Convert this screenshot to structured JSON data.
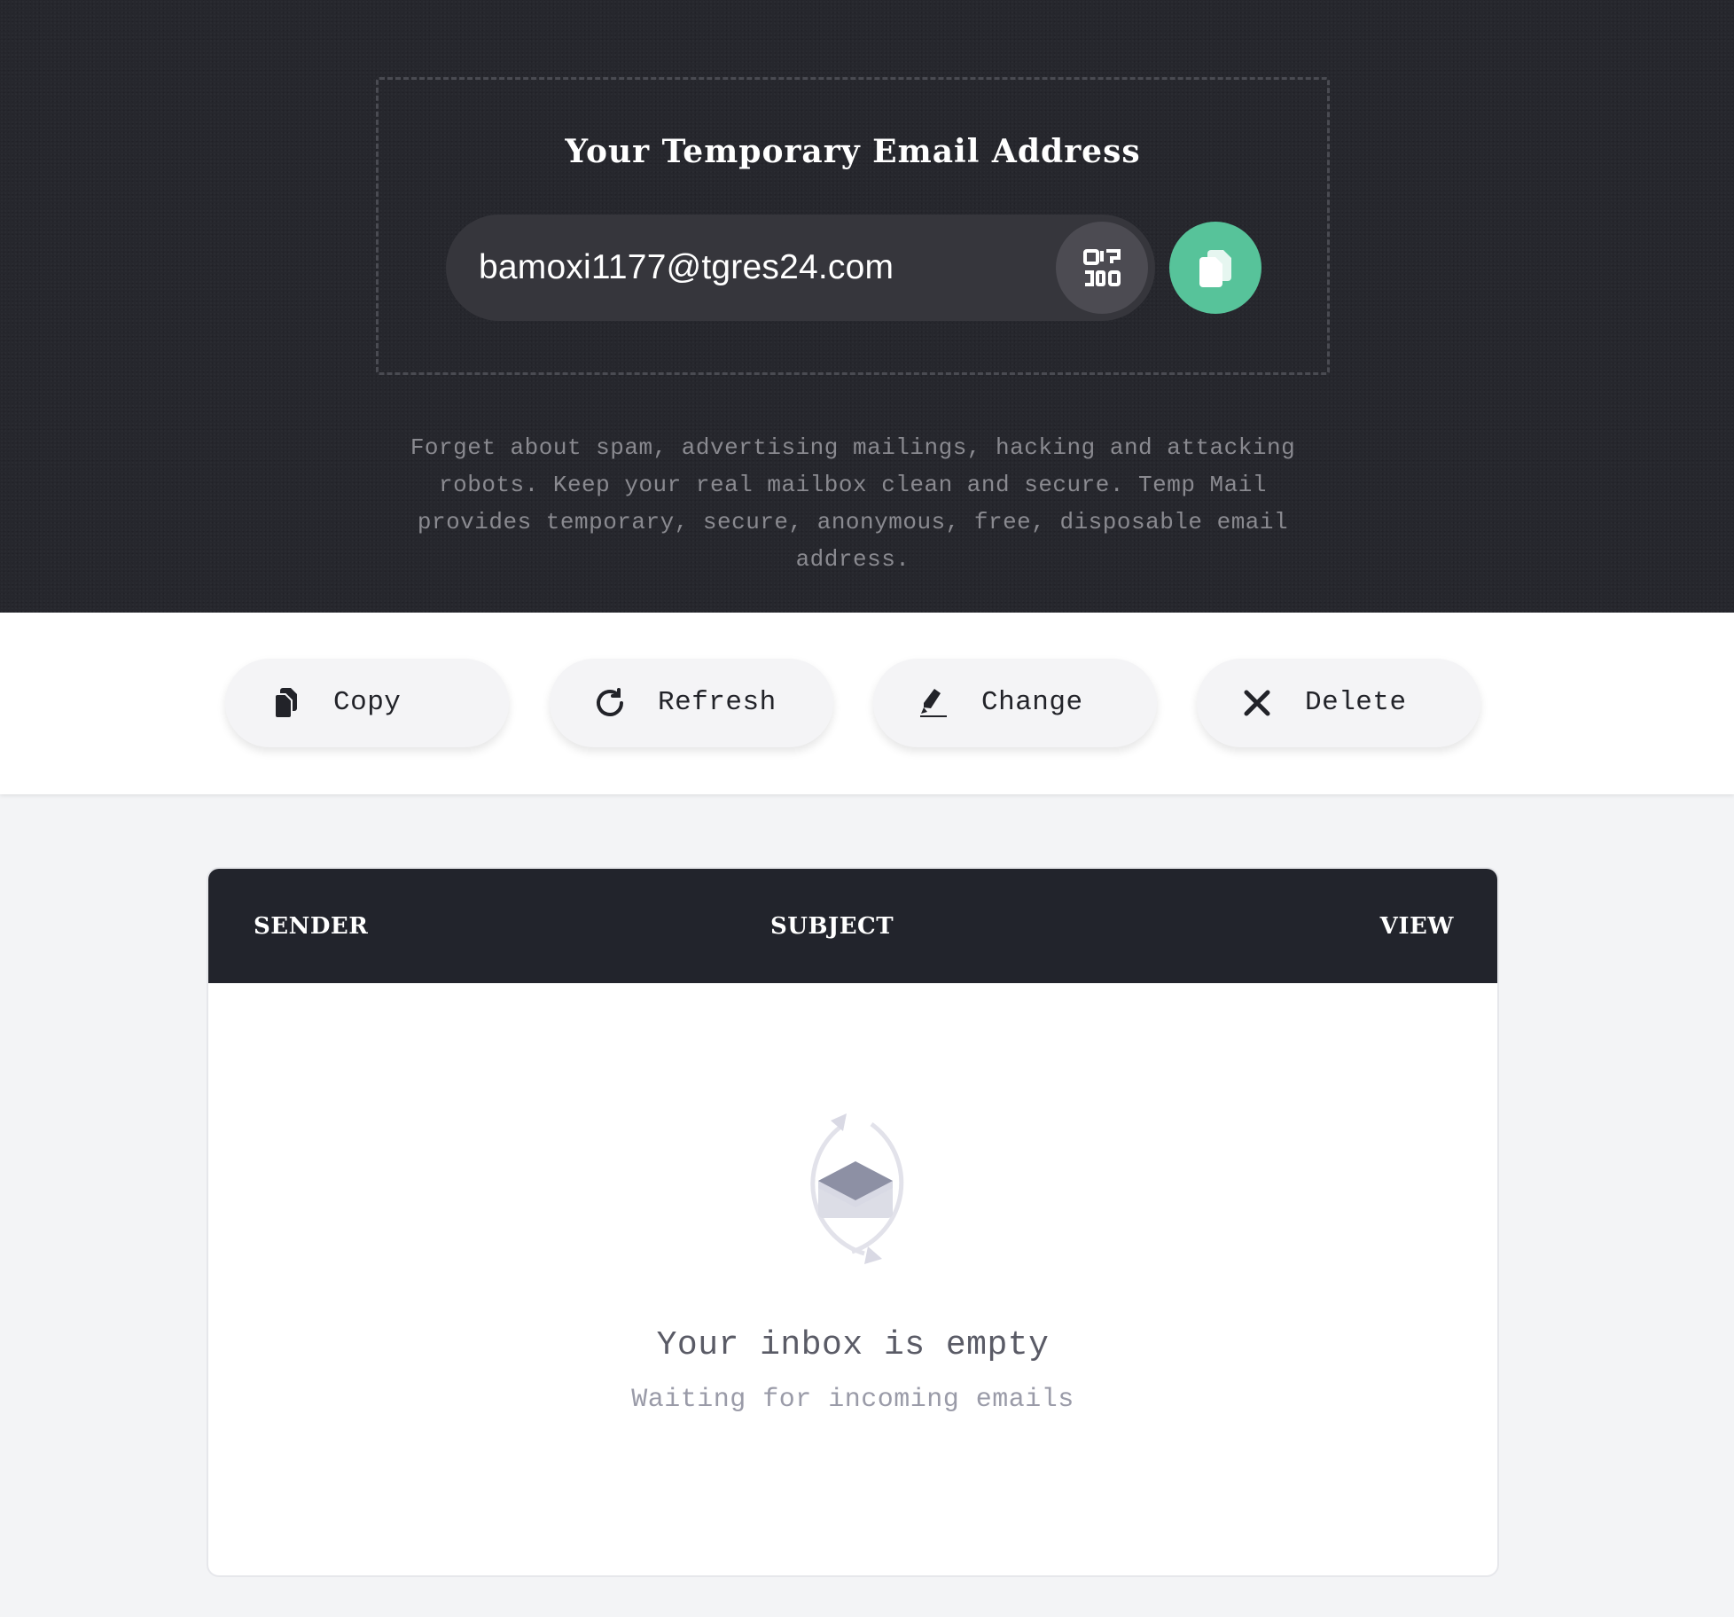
{
  "hero": {
    "title": "Your Temporary Email Address",
    "email": "bamoxi1177@tgres24.com",
    "description": "Forget about spam, advertising mailings, hacking and attacking robots. Keep your real mailbox clean and secure. Temp Mail provides temporary, secure, anonymous, free, disposable email address.",
    "qr_icon": "qr-code-icon",
    "copy_icon": "copy-icon"
  },
  "toolbar": {
    "buttons": [
      {
        "label": "Copy",
        "icon": "copy-icon"
      },
      {
        "label": "Refresh",
        "icon": "refresh-icon"
      },
      {
        "label": "Change",
        "icon": "pen-icon"
      },
      {
        "label": "Delete",
        "icon": "close-icon"
      }
    ]
  },
  "inbox": {
    "columns": [
      "SENDER",
      "SUBJECT",
      "VIEW"
    ],
    "empty_title": "Your inbox is empty",
    "empty_subtitle": "Waiting for incoming emails"
  },
  "colors": {
    "hero_bg": "#26272d",
    "accent": "#57c39a",
    "table_header": "#22242c",
    "page_bg": "#f3f4f6"
  }
}
